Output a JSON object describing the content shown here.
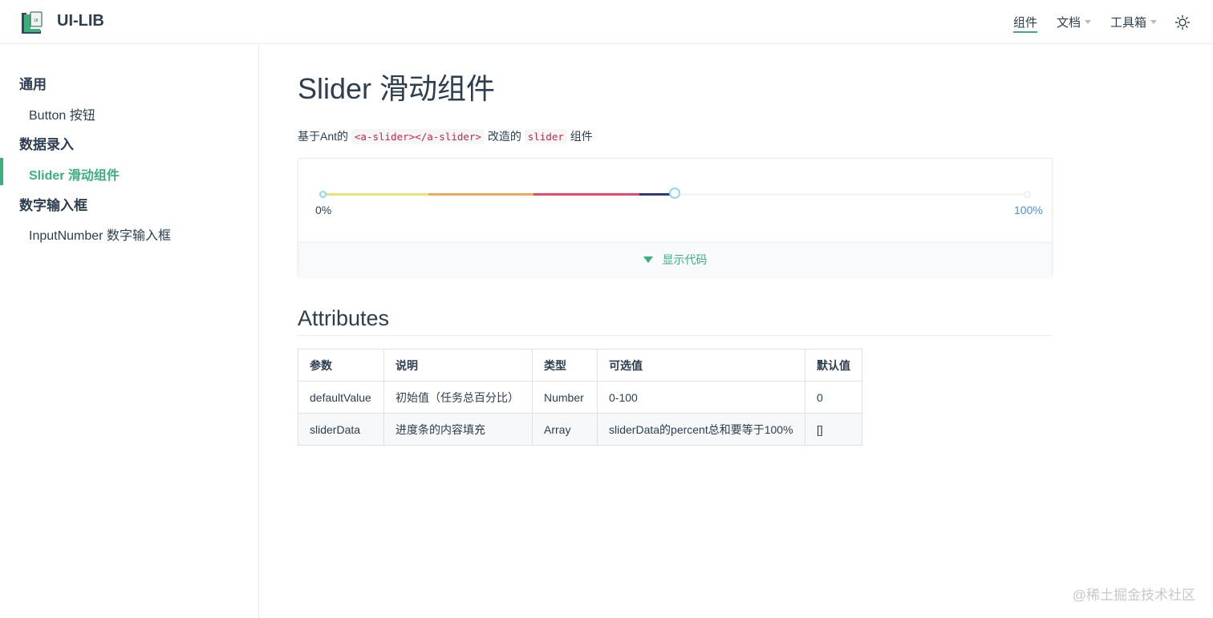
{
  "navbar": {
    "site_name": "UI-LIB",
    "links": [
      {
        "label": "组件",
        "active": true,
        "dropdown": false
      },
      {
        "label": "文档",
        "active": false,
        "dropdown": true
      },
      {
        "label": "工具箱",
        "active": false,
        "dropdown": true
      }
    ],
    "theme_icon": "sun-icon"
  },
  "sidebar": {
    "groups": [
      {
        "title": "通用",
        "items": [
          {
            "label": "Button 按钮",
            "active": false
          }
        ]
      },
      {
        "title": "数据录入",
        "items": [
          {
            "label": "Slider 滑动组件",
            "active": true
          }
        ]
      },
      {
        "title": "数字输入框",
        "items": [
          {
            "label": "InputNumber 数字输入框",
            "active": false
          }
        ]
      }
    ]
  },
  "main": {
    "title": "Slider 滑动组件",
    "description": {
      "prefix": "基于Ant的 ",
      "code1": "<a-slider></a-slider>",
      "middle": " 改造的 ",
      "code2": "slider",
      "suffix": " 组件"
    },
    "demo": {
      "min_label": "0%",
      "max_label": "100%",
      "value": 50,
      "segments": [
        {
          "percent": 15,
          "color": "#e8e27a"
        },
        {
          "percent": 15,
          "color": "#f0a860"
        },
        {
          "percent": 15,
          "color": "#e84a6e"
        },
        {
          "percent": 5,
          "color": "#2b3a78"
        }
      ],
      "toggle_label": "显示代码"
    },
    "attributes_title": "Attributes",
    "table": {
      "headers": [
        "参数",
        "说明",
        "类型",
        "可选值",
        "默认值"
      ],
      "rows": [
        [
          "defaultValue",
          "初始值（任务总百分比）",
          "Number",
          "0-100",
          "0"
        ],
        [
          "sliderData",
          "进度条的内容填充",
          "Array",
          "sliderData的percent总和要等于100%",
          "[]"
        ]
      ]
    }
  },
  "watermark": "@稀土掘金技术社区",
  "colors": {
    "accent": "#3eaf7c",
    "text": "#2c3e50",
    "handle_border": "#91d5ff"
  }
}
